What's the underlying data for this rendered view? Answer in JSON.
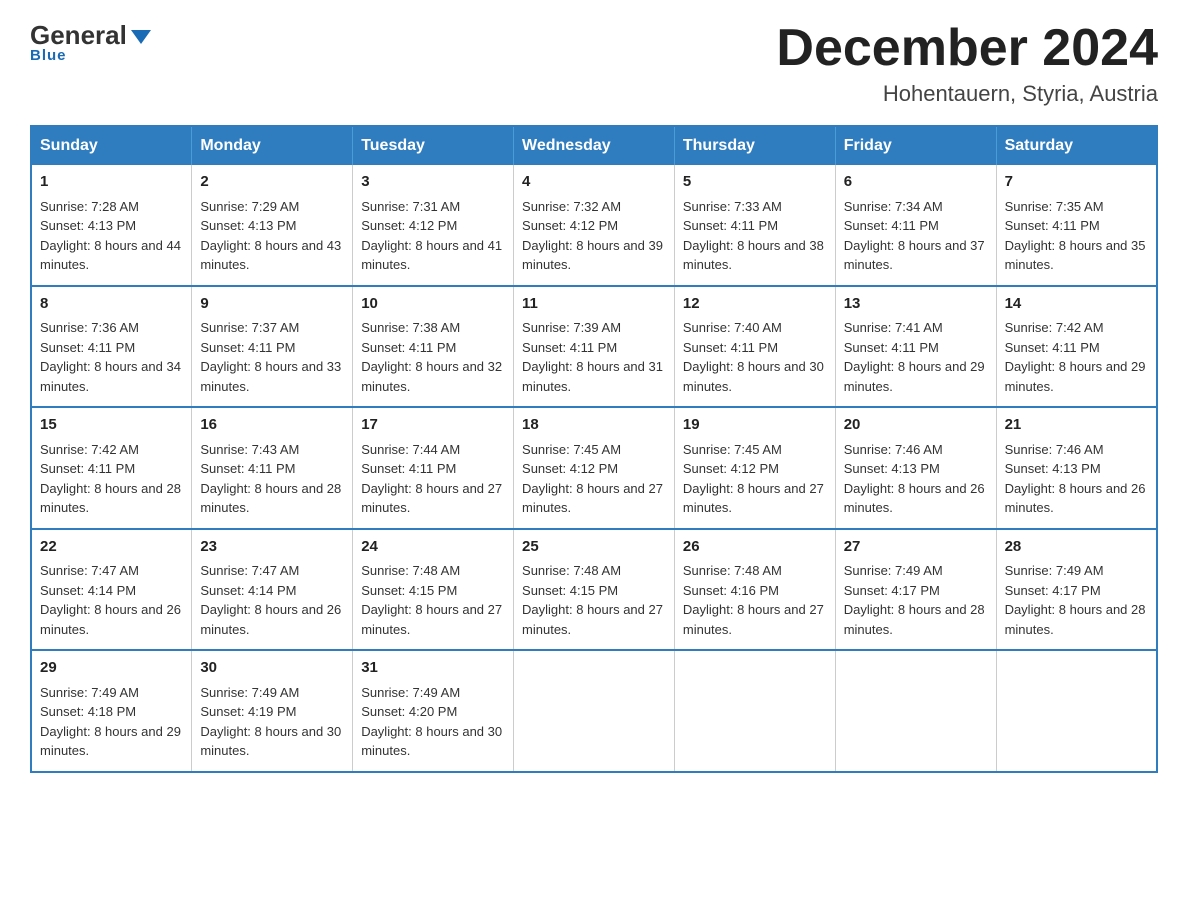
{
  "header": {
    "logo_general": "General",
    "logo_blue": "Blue",
    "month_title": "December 2024",
    "location": "Hohentauern, Styria, Austria"
  },
  "days_of_week": [
    "Sunday",
    "Monday",
    "Tuesday",
    "Wednesday",
    "Thursday",
    "Friday",
    "Saturday"
  ],
  "weeks": [
    [
      {
        "day": "1",
        "sunrise": "7:28 AM",
        "sunset": "4:13 PM",
        "daylight": "8 hours and 44 minutes."
      },
      {
        "day": "2",
        "sunrise": "7:29 AM",
        "sunset": "4:13 PM",
        "daylight": "8 hours and 43 minutes."
      },
      {
        "day": "3",
        "sunrise": "7:31 AM",
        "sunset": "4:12 PM",
        "daylight": "8 hours and 41 minutes."
      },
      {
        "day": "4",
        "sunrise": "7:32 AM",
        "sunset": "4:12 PM",
        "daylight": "8 hours and 39 minutes."
      },
      {
        "day": "5",
        "sunrise": "7:33 AM",
        "sunset": "4:11 PM",
        "daylight": "8 hours and 38 minutes."
      },
      {
        "day": "6",
        "sunrise": "7:34 AM",
        "sunset": "4:11 PM",
        "daylight": "8 hours and 37 minutes."
      },
      {
        "day": "7",
        "sunrise": "7:35 AM",
        "sunset": "4:11 PM",
        "daylight": "8 hours and 35 minutes."
      }
    ],
    [
      {
        "day": "8",
        "sunrise": "7:36 AM",
        "sunset": "4:11 PM",
        "daylight": "8 hours and 34 minutes."
      },
      {
        "day": "9",
        "sunrise": "7:37 AM",
        "sunset": "4:11 PM",
        "daylight": "8 hours and 33 minutes."
      },
      {
        "day": "10",
        "sunrise": "7:38 AM",
        "sunset": "4:11 PM",
        "daylight": "8 hours and 32 minutes."
      },
      {
        "day": "11",
        "sunrise": "7:39 AM",
        "sunset": "4:11 PM",
        "daylight": "8 hours and 31 minutes."
      },
      {
        "day": "12",
        "sunrise": "7:40 AM",
        "sunset": "4:11 PM",
        "daylight": "8 hours and 30 minutes."
      },
      {
        "day": "13",
        "sunrise": "7:41 AM",
        "sunset": "4:11 PM",
        "daylight": "8 hours and 29 minutes."
      },
      {
        "day": "14",
        "sunrise": "7:42 AM",
        "sunset": "4:11 PM",
        "daylight": "8 hours and 29 minutes."
      }
    ],
    [
      {
        "day": "15",
        "sunrise": "7:42 AM",
        "sunset": "4:11 PM",
        "daylight": "8 hours and 28 minutes."
      },
      {
        "day": "16",
        "sunrise": "7:43 AM",
        "sunset": "4:11 PM",
        "daylight": "8 hours and 28 minutes."
      },
      {
        "day": "17",
        "sunrise": "7:44 AM",
        "sunset": "4:11 PM",
        "daylight": "8 hours and 27 minutes."
      },
      {
        "day": "18",
        "sunrise": "7:45 AM",
        "sunset": "4:12 PM",
        "daylight": "8 hours and 27 minutes."
      },
      {
        "day": "19",
        "sunrise": "7:45 AM",
        "sunset": "4:12 PM",
        "daylight": "8 hours and 27 minutes."
      },
      {
        "day": "20",
        "sunrise": "7:46 AM",
        "sunset": "4:13 PM",
        "daylight": "8 hours and 26 minutes."
      },
      {
        "day": "21",
        "sunrise": "7:46 AM",
        "sunset": "4:13 PM",
        "daylight": "8 hours and 26 minutes."
      }
    ],
    [
      {
        "day": "22",
        "sunrise": "7:47 AM",
        "sunset": "4:14 PM",
        "daylight": "8 hours and 26 minutes."
      },
      {
        "day": "23",
        "sunrise": "7:47 AM",
        "sunset": "4:14 PM",
        "daylight": "8 hours and 26 minutes."
      },
      {
        "day": "24",
        "sunrise": "7:48 AM",
        "sunset": "4:15 PM",
        "daylight": "8 hours and 27 minutes."
      },
      {
        "day": "25",
        "sunrise": "7:48 AM",
        "sunset": "4:15 PM",
        "daylight": "8 hours and 27 minutes."
      },
      {
        "day": "26",
        "sunrise": "7:48 AM",
        "sunset": "4:16 PM",
        "daylight": "8 hours and 27 minutes."
      },
      {
        "day": "27",
        "sunrise": "7:49 AM",
        "sunset": "4:17 PM",
        "daylight": "8 hours and 28 minutes."
      },
      {
        "day": "28",
        "sunrise": "7:49 AM",
        "sunset": "4:17 PM",
        "daylight": "8 hours and 28 minutes."
      }
    ],
    [
      {
        "day": "29",
        "sunrise": "7:49 AM",
        "sunset": "4:18 PM",
        "daylight": "8 hours and 29 minutes."
      },
      {
        "day": "30",
        "sunrise": "7:49 AM",
        "sunset": "4:19 PM",
        "daylight": "8 hours and 30 minutes."
      },
      {
        "day": "31",
        "sunrise": "7:49 AM",
        "sunset": "4:20 PM",
        "daylight": "8 hours and 30 minutes."
      },
      null,
      null,
      null,
      null
    ]
  ]
}
